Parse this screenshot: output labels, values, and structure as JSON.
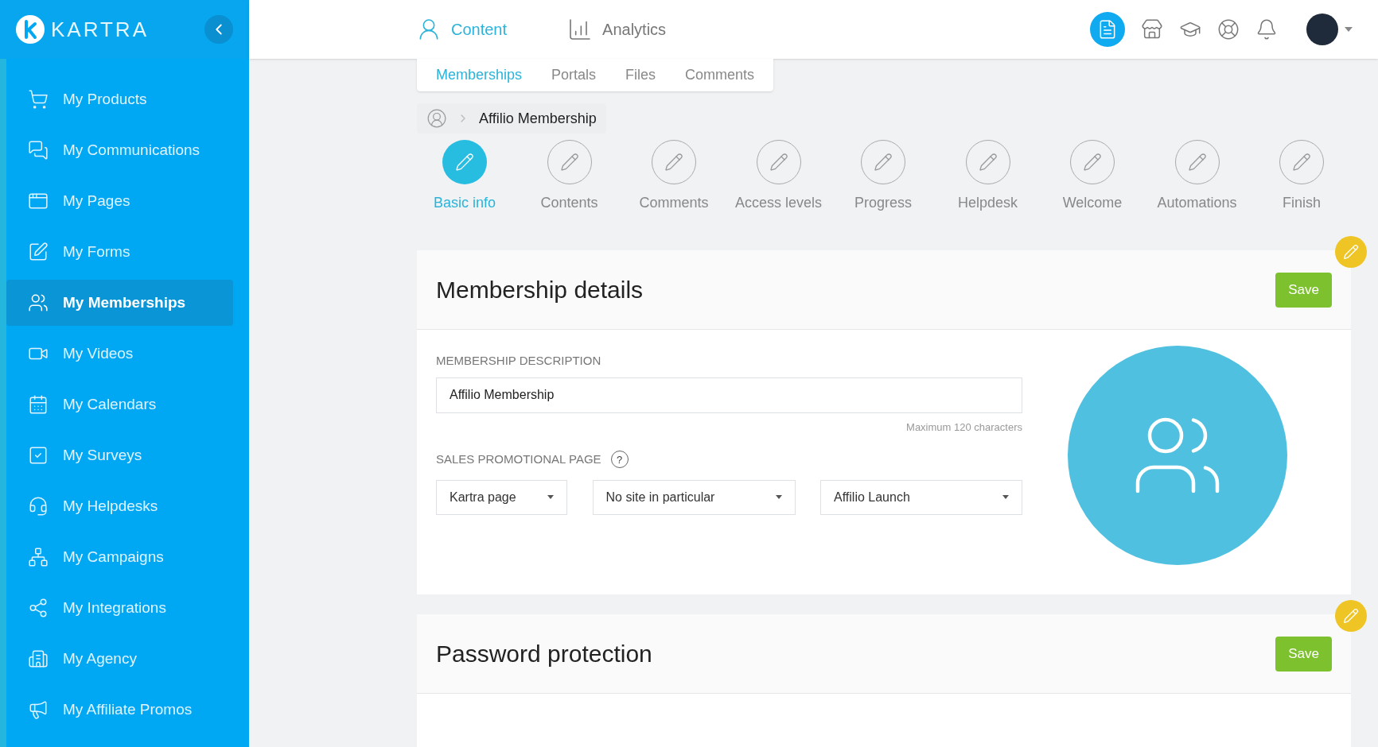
{
  "brand": {
    "name": "KARTRA"
  },
  "sidebar": {
    "items": [
      {
        "label": "My Products",
        "selected": false
      },
      {
        "label": "My Communications",
        "selected": false
      },
      {
        "label": "My Pages",
        "selected": false
      },
      {
        "label": "My Forms",
        "selected": false
      },
      {
        "label": "My Memberships",
        "selected": true
      },
      {
        "label": "My Videos",
        "selected": false
      },
      {
        "label": "My Calendars",
        "selected": false
      },
      {
        "label": "My Surveys",
        "selected": false
      },
      {
        "label": "My Helpdesks",
        "selected": false
      },
      {
        "label": "My Campaigns",
        "selected": false
      },
      {
        "label": "My Integrations",
        "selected": false
      },
      {
        "label": "My Agency",
        "selected": false
      },
      {
        "label": "My Affiliate Promos",
        "selected": false
      }
    ]
  },
  "top_nav": [
    {
      "label": "Content",
      "selected": true
    },
    {
      "label": "Analytics",
      "selected": false
    }
  ],
  "sub_tabs": [
    {
      "label": "Memberships",
      "selected": true
    },
    {
      "label": "Portals",
      "selected": false
    },
    {
      "label": "Files",
      "selected": false
    },
    {
      "label": "Comments",
      "selected": false
    }
  ],
  "breadcrumb": {
    "current": "Affilio Membership"
  },
  "steps": [
    {
      "label": "Basic info",
      "selected": true
    },
    {
      "label": "Contents",
      "selected": false
    },
    {
      "label": "Comments",
      "selected": false
    },
    {
      "label": "Access levels",
      "selected": false
    },
    {
      "label": "Progress",
      "selected": false
    },
    {
      "label": "Helpdesk",
      "selected": false
    },
    {
      "label": "Welcome",
      "selected": false
    },
    {
      "label": "Automations",
      "selected": false
    },
    {
      "label": "Finish",
      "selected": false
    }
  ],
  "details_card": {
    "title": "Membership details",
    "save": "Save",
    "description_label": "MEMBERSHIP DESCRIPTION",
    "description_value": "Affilio Membership",
    "description_hint": "Maximum 120 characters",
    "promo_label": "SALES PROMOTIONAL PAGE",
    "help": "?",
    "selects": [
      "Kartra page",
      "No site in particular",
      "Affilio Launch"
    ]
  },
  "password_card": {
    "title": "Password protection",
    "save": "Save"
  }
}
